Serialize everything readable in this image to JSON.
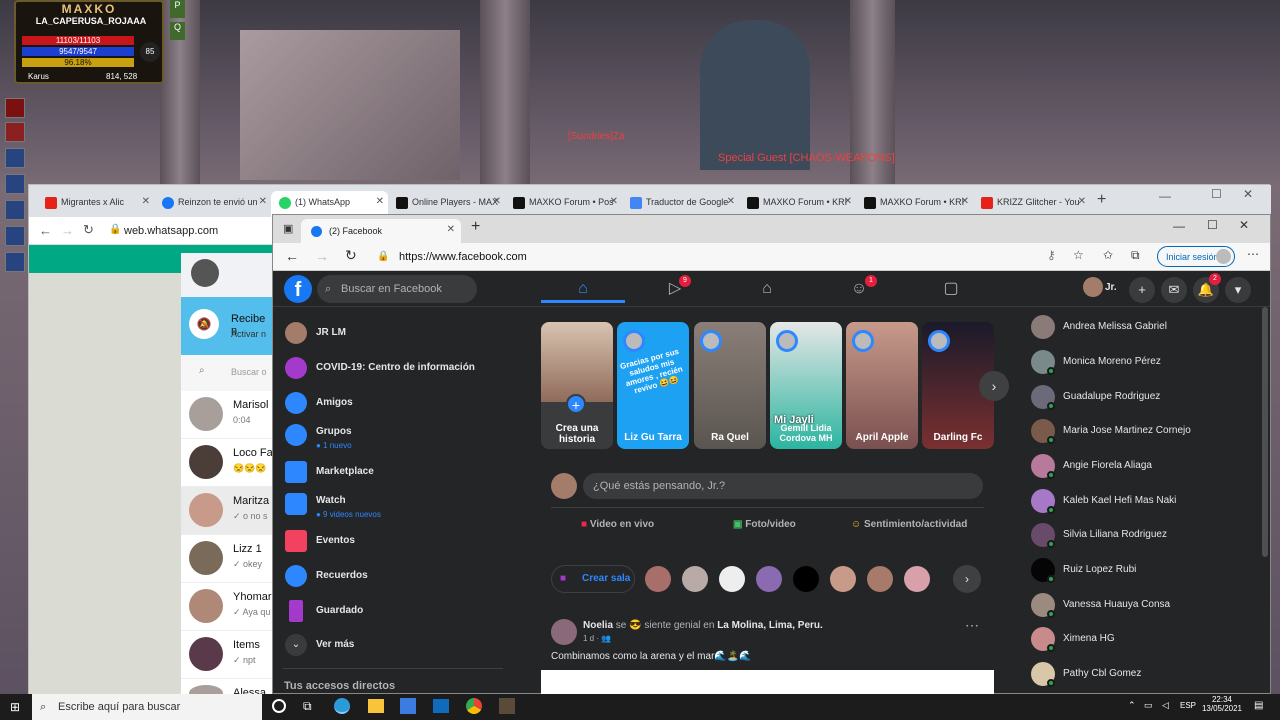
{
  "game": {
    "title": "MAXKO",
    "player": "LA_CAPERUSA_ROJAAA",
    "hp": "11103/11103",
    "mp": "9547/9547",
    "exp": "96.18%",
    "level": "85",
    "location": "Karus",
    "coords": "814, 528",
    "chat1": "[Sundries]Za",
    "chat2": "Special Guest [CHAOS-WEAPONS]"
  },
  "chrome": {
    "tabs": [
      "Migrantes x Alic",
      "Reinzon te envió un",
      "(1) WhatsApp",
      "Online Players - MAX",
      "MAXKO Forum • Pos",
      "Traductor de Google",
      "MAXKO Forum • KRI",
      "MAXKO Forum • KRI",
      "KRIZZ Glitcher - You"
    ],
    "url": "web.whatsapp.com",
    "newtab": "+"
  },
  "whatsapp": {
    "banner_title": "Recibe n",
    "banner_sub": "Activar n",
    "search_placeholder": "Buscar o",
    "chats": [
      {
        "name": "Marisol",
        "sub": "0:04"
      },
      {
        "name": "Loco Fac",
        "sub": "😒😒😒"
      },
      {
        "name": "Maritza",
        "sub": "✓ o no s"
      },
      {
        "name": "Lizz 1",
        "sub": "✓ okey"
      },
      {
        "name": "Yhomar",
        "sub": "✓ Aya qu"
      },
      {
        "name": "Items",
        "sub": "✓ npt"
      },
      {
        "name": "Alessa",
        "sub": ""
      }
    ]
  },
  "edge": {
    "tab_title": "(2) Facebook",
    "url": "https://www.facebook.com",
    "signin": "Iniciar sesión"
  },
  "facebook": {
    "search_placeholder": "Buscar en Facebook",
    "video_badge": "9",
    "groups_badge": "1",
    "notif_badge": "2",
    "user": "Jr.",
    "nav": [
      {
        "label": "JR LM",
        "sub": ""
      },
      {
        "label": "COVID-19: Centro de información",
        "sub": ""
      },
      {
        "label": "Amigos",
        "sub": ""
      },
      {
        "label": "Grupos",
        "sub": "● 1 nuevo"
      },
      {
        "label": "Marketplace",
        "sub": ""
      },
      {
        "label": "Watch",
        "sub": "● 9 videos nuevos"
      },
      {
        "label": "Eventos",
        "sub": ""
      },
      {
        "label": "Recuerdos",
        "sub": ""
      },
      {
        "label": "Guardado",
        "sub": ""
      },
      {
        "label": "Ver más",
        "sub": ""
      }
    ],
    "shortcuts_title": "Tus accesos directos",
    "stories": [
      {
        "name": "Crea una historia",
        "text": ""
      },
      {
        "name": "Liz Gu Tarra",
        "text": "Gracias por sus saludos mis amores , recién revivo 😆😆"
      },
      {
        "name": "Ra Quel",
        "text": ""
      },
      {
        "name": "Gemill Lidia Cordova MH",
        "text": "Mi Jayli"
      },
      {
        "name": "April Apple",
        "text": ""
      },
      {
        "name": "Darling Fc",
        "text": ""
      }
    ],
    "composer": {
      "placeholder": "¿Qué estás pensando, Jr.?",
      "live": "Video en vivo",
      "photo": "Foto/video",
      "feeling": "Sentimiento/actividad"
    },
    "room": "Crear sala",
    "post": {
      "author": "Noelia",
      "feeling": "se 😎 siente genial en",
      "place": "La Molina, Lima, Peru.",
      "time": "1 d · 👥",
      "text": "Combinamos como la arena y el mar🌊🏝️🌊"
    },
    "contacts": [
      "Andrea Melissa Gabriel",
      "Monica Moreno Pérez",
      "Guadalupe Rodriguez",
      "Maria Jose Martinez Cornejo",
      "Angie Fiorela Aliaga",
      "Kaleb Kael Hefi Mas Naki",
      "Silvia Liliana Rodriguez",
      "Ruiz Lopez Rubi",
      "Vanessa Huauya Consa",
      "Ximena HG",
      "Pathy Cbl Gomez"
    ]
  },
  "taskbar": {
    "search": "Escribe aquí para buscar",
    "lang": "ESP",
    "time": "22:34",
    "date": "13/05/2021"
  }
}
